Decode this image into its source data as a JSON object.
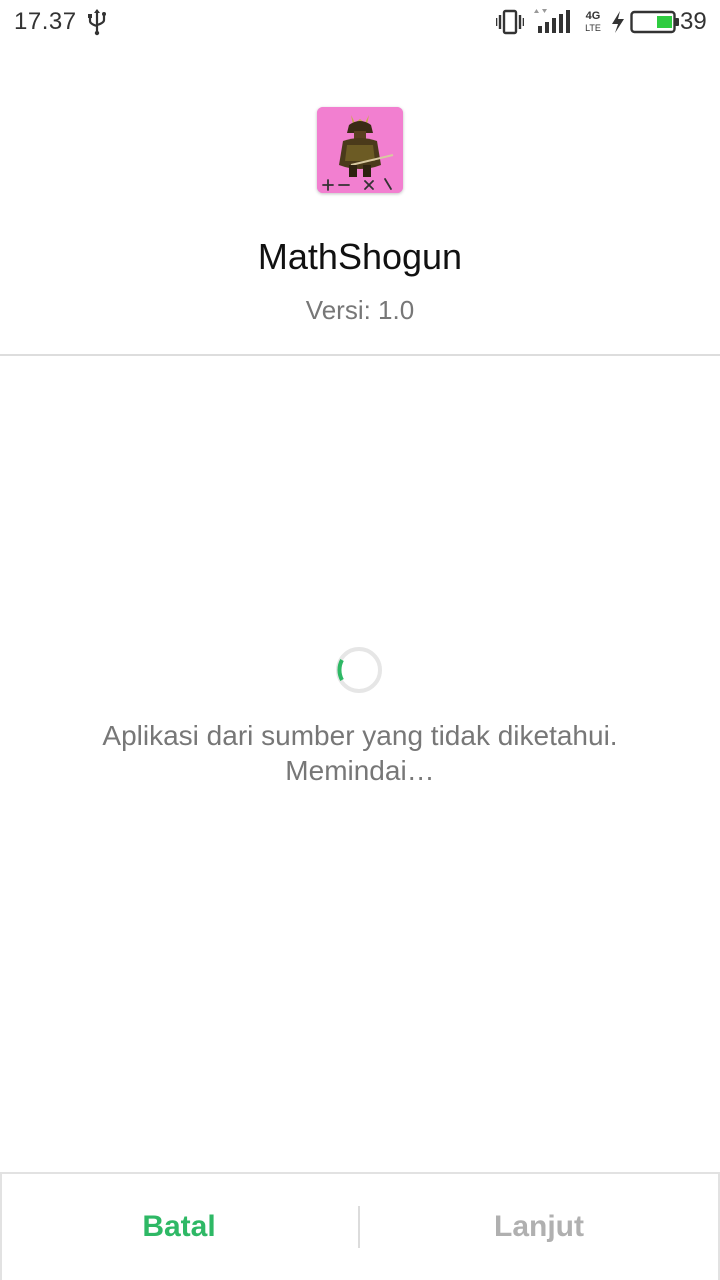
{
  "status_bar": {
    "time": "17.37",
    "network_type_top": "4G",
    "network_type_bottom": "LTE",
    "battery_level": "39",
    "battery_fill_fraction": 0.39,
    "battery_color": "#2ecc40",
    "icons": [
      "usb-icon",
      "vibrate-icon",
      "signal-icon",
      "charging-icon",
      "battery-icon"
    ]
  },
  "app": {
    "name": "MathShogun",
    "version": "Versi: 1.0",
    "icon_name": "mathshogun-app-icon",
    "icon_background": "#f27fd0"
  },
  "scan": {
    "message_line1": "Aplikasi dari sumber yang tidak diketahui.",
    "message_line2": "Memindai…",
    "spinner_color": "#2eb865"
  },
  "actions": {
    "cancel_label": "Batal",
    "next_label": "Lanjut",
    "accent_color": "#2eb865",
    "disabled_color": "#b0b0b0"
  }
}
